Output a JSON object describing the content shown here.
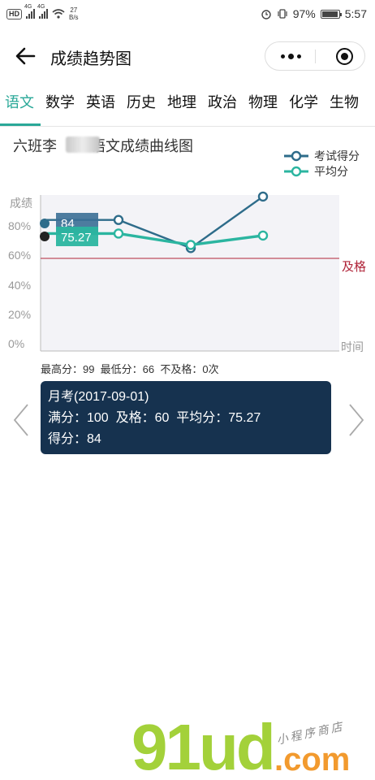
{
  "status_bar": {
    "hd": "HD",
    "signal_label": "4G",
    "speed_value": "27",
    "speed_unit": "B/s",
    "battery": "97%",
    "time": "5:57"
  },
  "nav": {
    "title": "成绩趋势图"
  },
  "tabs": [
    {
      "label": "语文",
      "active": true
    },
    {
      "label": "数学"
    },
    {
      "label": "英语"
    },
    {
      "label": "历史"
    },
    {
      "label": "地理"
    },
    {
      "label": "政治"
    },
    {
      "label": "物理"
    },
    {
      "label": "化学"
    },
    {
      "label": "生物"
    }
  ],
  "chart": {
    "title_prefix": "六班李",
    "title_suffix": "语文成绩曲线图"
  },
  "chart_data": {
    "type": "line",
    "ylabel": "成绩",
    "xlabel": "时间",
    "y_ticks": [
      "80%",
      "60%",
      "40%",
      "20%",
      "0%"
    ],
    "ylim": [
      0,
      100
    ],
    "pass_line": {
      "value": 60,
      "label": "及格",
      "color": "#b0253a"
    },
    "series": [
      {
        "name": "考试得分",
        "color": "#2e6c8a",
        "values": [
          84,
          84,
          66,
          99
        ]
      },
      {
        "name": "平均分",
        "color": "#2bb5a0",
        "values": [
          75.27,
          75.27,
          68,
          74
        ]
      }
    ],
    "tooltip": {
      "score": "84",
      "average": "75.27"
    },
    "legend_position": "top-right",
    "grid": false
  },
  "stats": {
    "text": "最高分：99  最低分：66  不及格：0次"
  },
  "detail": {
    "exam": "月考(2017-09-01)",
    "line2": "满分：100  及格：60  平均分：75.27",
    "score": "得分：84"
  },
  "colors": {
    "accent": "#2aa898",
    "detail_bg": "#16324f",
    "score_line": "#2e6c8a",
    "avg_line": "#2bb5a0"
  },
  "watermark": {
    "main": "91ud",
    "suffix": ".com",
    "sub": "小程序商店"
  }
}
